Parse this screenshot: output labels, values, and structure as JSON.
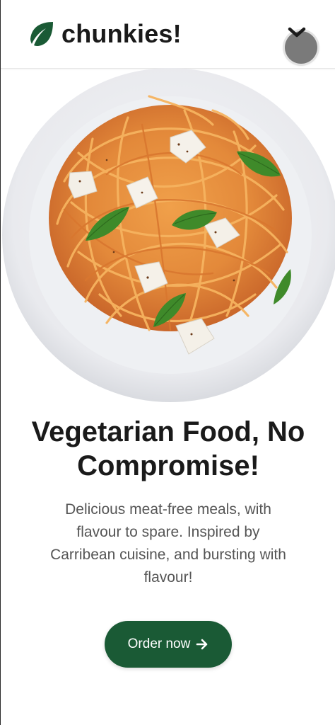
{
  "header": {
    "brand_name": "chunkies!",
    "logo_icon": "leaf-icon",
    "menu_icon": "chevron-down-icon"
  },
  "hero": {
    "image": "spaghetti-with-tomato-sauce-basil-and-tofu-cubes"
  },
  "content": {
    "headline_line1": "Vegetarian Food, No",
    "headline_line2": "Compromise!",
    "description": "Delicious meat-free meals, with flavour to spare. Inspired by Carribean cuisine, and bursting with flavour!"
  },
  "cta": {
    "label": "Order now",
    "icon": "arrow-right-icon"
  },
  "colors": {
    "brand_green": "#1a5a35",
    "text_dark": "#1a1a1a",
    "text_muted": "#555555"
  }
}
